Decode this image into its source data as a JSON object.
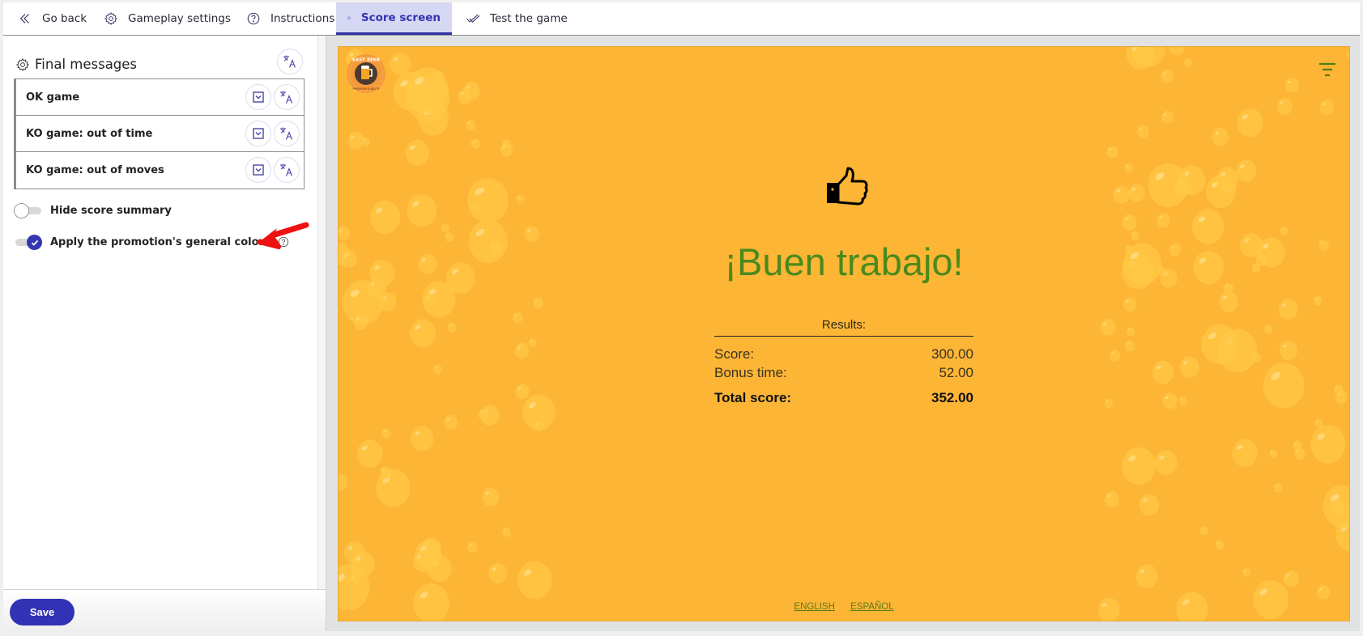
{
  "tabs": [
    {
      "label": "Go back",
      "icon": "double-chevron-left-icon"
    },
    {
      "label": "Gameplay settings",
      "icon": "gear-icon"
    },
    {
      "label": "Instructions",
      "icon": "question-circle-icon"
    },
    {
      "label": "Score screen",
      "icon": "thumbs-up-icon",
      "active": true
    },
    {
      "label": "Test the game",
      "icon": "double-check-icon"
    }
  ],
  "left_panel": {
    "section_title": "Final messages",
    "messages": [
      {
        "label": "OK game"
      },
      {
        "label": "KO game: out of time"
      },
      {
        "label": "KO game: out of moves"
      }
    ],
    "toggles": [
      {
        "label": "Hide score summary",
        "checked": false
      },
      {
        "label": "Apply the promotion's general colors",
        "checked": true,
        "help": true
      }
    ],
    "save_label": "Save"
  },
  "preview": {
    "logo_text_top": "EASY BEER",
    "logo_text_bottom": "PREMIUM QUALITY",
    "headline": "¡Buen trabajo!",
    "results_title": "Results:",
    "rows": [
      {
        "label": "Score:",
        "value": "300.00"
      },
      {
        "label": "Bonus time:",
        "value": "52.00"
      }
    ],
    "total": {
      "label": "Total score:",
      "value": "352.00"
    },
    "languages": [
      "ENGLISH",
      "ESPAÑOL"
    ]
  },
  "colors": {
    "accent": "#3232b4",
    "tab_active_bg": "#d5d7f3",
    "game_bg": "#fdb536",
    "headline": "#4a8a1c",
    "annotation_arrow": "#ee1111"
  }
}
